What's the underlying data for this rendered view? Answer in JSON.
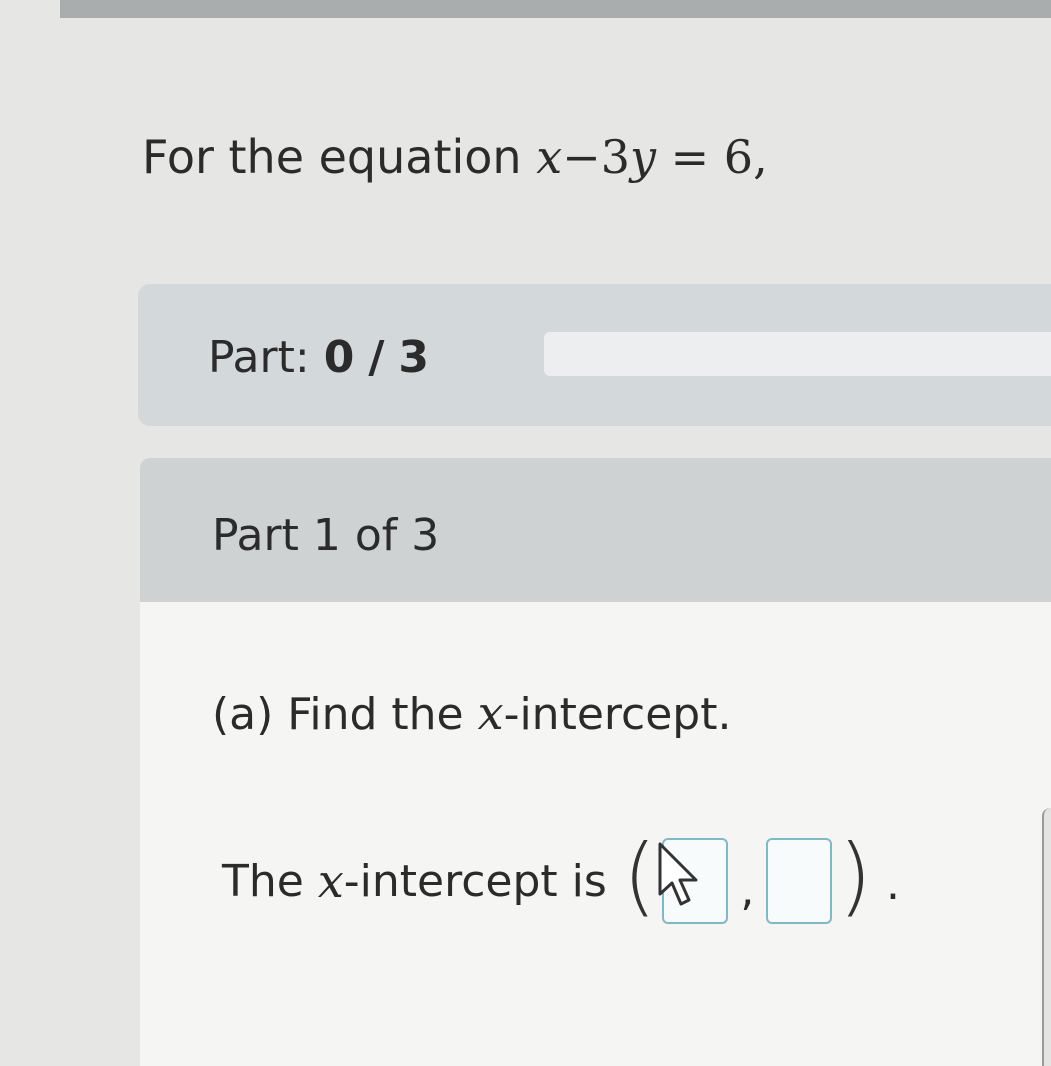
{
  "question": {
    "prefix": "For the equation",
    "equation": {
      "var_x": "x",
      "minus": "−",
      "coef": "3",
      "var_y": "y",
      "equals": "=",
      "rhs": "6",
      "trail": ","
    }
  },
  "progress": {
    "label": "Part:",
    "current": "0",
    "separator": "/",
    "total": "3",
    "fraction_complete": 0,
    "fill_color": "#2a8fc1"
  },
  "part_panel": {
    "title": "Part 1 of 3",
    "question_a": {
      "prefix": "(a) Find the",
      "var": "x",
      "suffix": "-intercept."
    },
    "answer": {
      "prefix": "The",
      "var": "x",
      "suffix": "-intercept is",
      "open_paren": "(",
      "comma": ",",
      "close_paren": ")",
      "period": ".",
      "box1_value": "",
      "box2_value": ""
    }
  },
  "icons": {
    "cursor": "mouse-pointer-icon"
  }
}
